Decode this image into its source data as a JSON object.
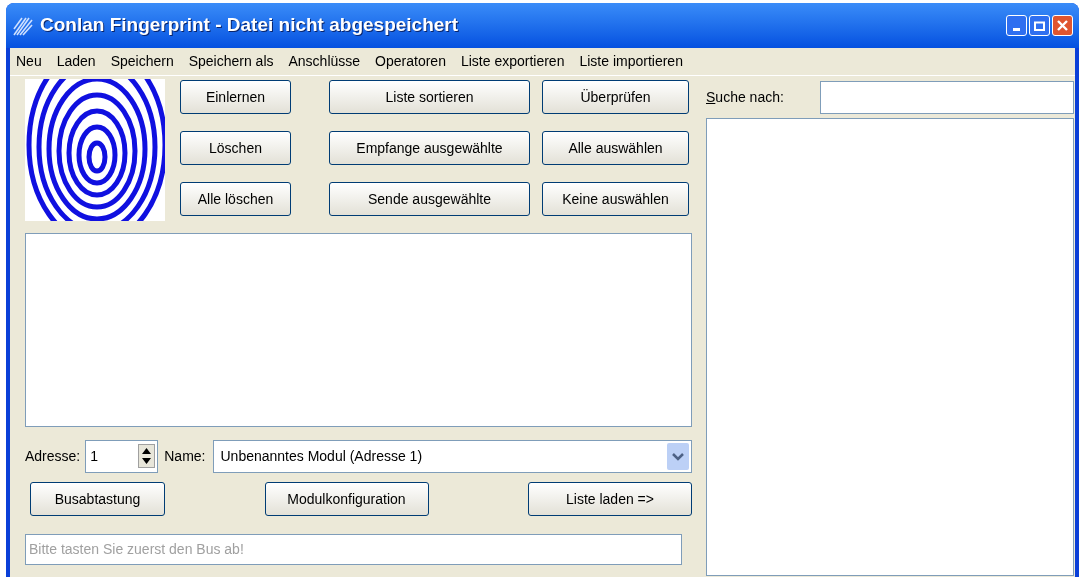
{
  "window": {
    "title": "Conlan Fingerprint - Datei nicht abgespeichert"
  },
  "menu": [
    "Neu",
    "Laden",
    "Speichern",
    "Speichern als",
    "Anschlüsse",
    "Operatoren",
    "Liste exportieren",
    "Liste importieren"
  ],
  "button_columns": [
    [
      "Einlernen",
      "Löschen",
      "Alle löschen"
    ],
    [
      "Liste sortieren",
      "Empfange ausgewählte",
      "Sende ausgewählte"
    ],
    [
      "Überprüfen",
      "Alle auswählen",
      "Keine auswählen"
    ]
  ],
  "address": {
    "label": "Adresse:",
    "value": "1"
  },
  "name": {
    "label": "Name:",
    "value": "Unbenanntes Modul (Adresse 1)"
  },
  "bottom_buttons": [
    "Busabtastung",
    "Modulkonfiguration",
    "Liste laden =>"
  ],
  "status_field": {
    "text": "Bitte tasten Sie zuerst den Bus ab!",
    "disabled": true
  },
  "search": {
    "label": "Suche nach:"
  }
}
